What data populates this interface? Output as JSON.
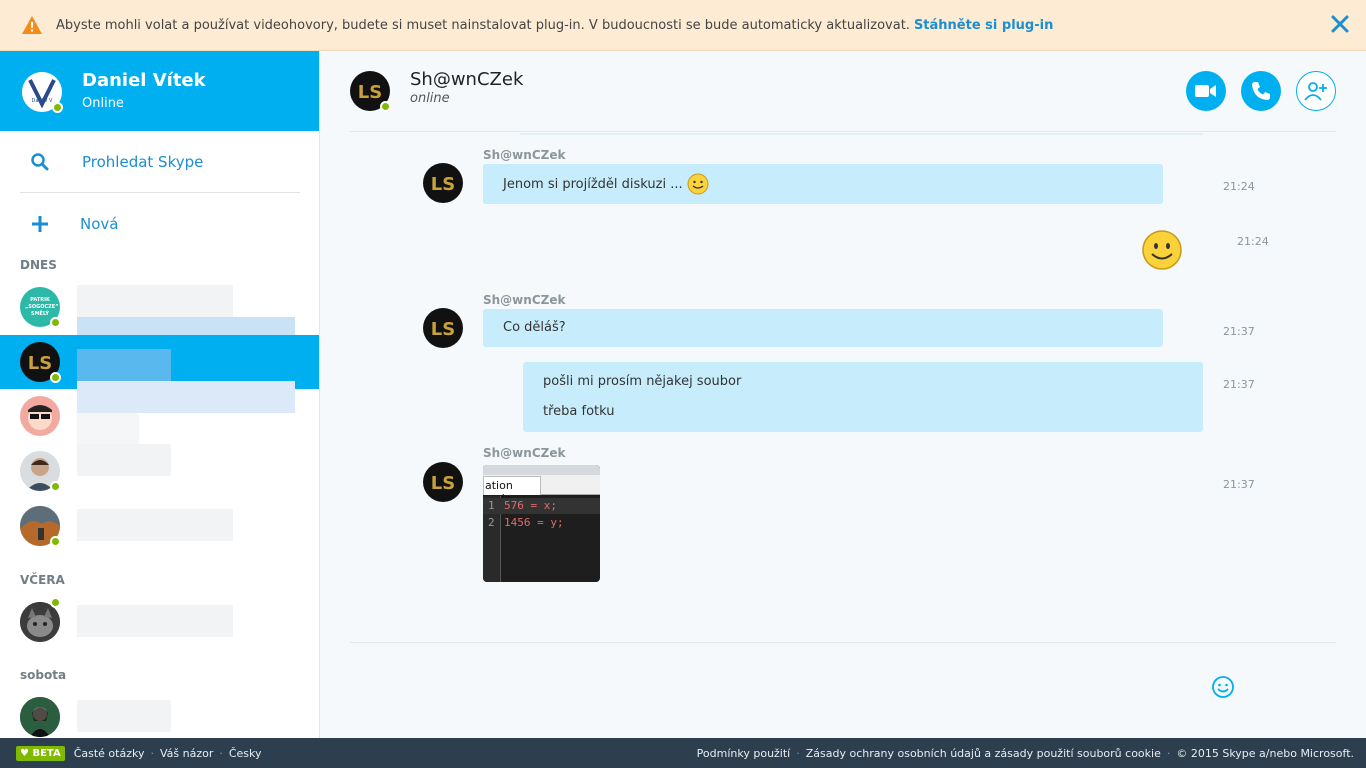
{
  "banner": {
    "message": "Abyste mohli volat a používat videohovory, budete si muset nainstalovat plug-in. V budoucnosti se bude automaticky aktualizovat.",
    "link": "Stáhněte si plug-in",
    "icons": {
      "warning": "warning-icon",
      "close": "close-icon"
    }
  },
  "profile": {
    "name": "Daniel Vítek",
    "status": "Online",
    "avatar_text": "Daniel V"
  },
  "sidebar": {
    "search_label": "Prohledat Skype",
    "new_label": "Nová",
    "sections": {
      "today": "DNES",
      "yesterday": "VČERA",
      "saturday": "sobota"
    },
    "first_avatar_text": "PATRIK „SOGOCZE“ SMĚLÝ"
  },
  "chat": {
    "contact_name": "Sh@wnCZek",
    "contact_status": "online",
    "avatar_initials": "LS",
    "messages": [
      {
        "sender": "Sh@wnCZek",
        "text": "Jenom si projížděl diskuzi ...",
        "time": "21:24"
      },
      {
        "sender": "me",
        "text": "",
        "time": "21:24"
      },
      {
        "sender": "Sh@wnCZek",
        "text": "Co děláš?",
        "time": "21:37"
      },
      {
        "sender": "me",
        "lines": [
          "pošli mi prosím nějakej soubor",
          "třeba fotku"
        ],
        "time": "21:37"
      },
      {
        "sender": "Sh@wnCZek",
        "image": {
          "tab_label": "ation code",
          "code_lines": [
            {
              "num": "1",
              "code": "576 = x;"
            },
            {
              "num": "2",
              "code": "1456 = y;"
            }
          ]
        },
        "time": "21:37"
      }
    ]
  },
  "footer": {
    "beta": "♥ BETA",
    "left_links": [
      "Časté otázky",
      "Váš názor",
      "Česky"
    ],
    "right_links": [
      "Podmínky použití",
      "Zásady ochrany osobních údajů a zásady použití souborů cookie",
      "© 2015 Skype a/nebo Microsoft."
    ],
    "separator": "·"
  },
  "colors": {
    "accent": "#00aff0",
    "online": "#7fba00",
    "banner_bg": "#fdebd3",
    "footer_bg": "#2d3e4e",
    "bubble": "#c7edfc"
  }
}
